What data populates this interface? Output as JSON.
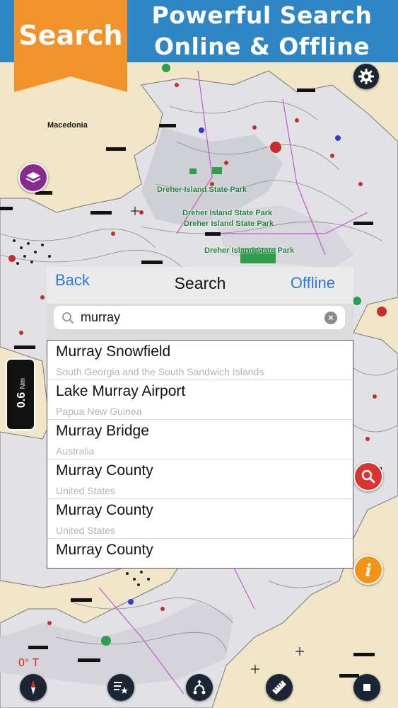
{
  "banner": {
    "ribbon_label": "Search",
    "title_line1": "Powerful Search",
    "title_line2": "Online & Offline"
  },
  "map": {
    "place_labels": [
      "Macedonia"
    ],
    "park_labels": [
      "Dreher Island State Park",
      "Dreher Island State Park",
      "Dreher Island State Park",
      "Dreher Island State Park"
    ],
    "scale": {
      "value": "0.6",
      "unit": "Nm"
    },
    "heading": "0° T"
  },
  "search_panel": {
    "back_label": "Back",
    "title": "Search",
    "offline_label": "Offline",
    "query": "murray",
    "results": [
      {
        "title": "Murray Snowfield",
        "subtitle": "South Georgia and the South Sandwich Islands"
      },
      {
        "title": "Lake Murray Airport",
        "subtitle": "Papua New Guinea"
      },
      {
        "title": "Murray Bridge",
        "subtitle": "Australia"
      },
      {
        "title": "Murray County",
        "subtitle": "United States"
      },
      {
        "title": "Murray County",
        "subtitle": "United States"
      },
      {
        "title": "Murray County",
        "subtitle": ""
      }
    ]
  },
  "icons": {
    "settings": "gear-icon",
    "layers": "layers-icon",
    "search": "magnifier-icon",
    "info": "info-icon",
    "compass": "compass-icon",
    "favorites": "star-list-icon",
    "route": "route-icon",
    "measure": "ruler-icon",
    "stop": "stop-icon"
  },
  "colors": {
    "banner_blue": "#2f86c4",
    "ribbon_orange": "#f2922a",
    "link_blue": "#2a7ad8",
    "water": "#e6e6ea",
    "land": "#f1e6c8",
    "park_green": "#1f7e3a"
  }
}
